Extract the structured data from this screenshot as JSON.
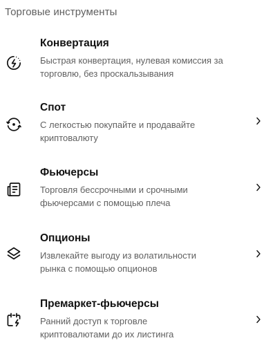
{
  "section": {
    "title": "Торговые инструменты"
  },
  "items": [
    {
      "name": "Конвертация",
      "desc_line1": "Быстрая конвертация, нулевая комиссия за",
      "desc_line2": "торговлю, без проскальзывания",
      "icon": "convert-icon",
      "has_chevron": false
    },
    {
      "name": "Спот",
      "desc_line1": "С легкостью покупайте и продавайте",
      "desc_line2": "криптовалюту",
      "icon": "spot-icon",
      "has_chevron": true
    },
    {
      "name": "Фьючерсы",
      "desc_line1": "Торговля бессрочными и срочными",
      "desc_line2": "фьючерсами с помощью плеча",
      "icon": "futures-icon",
      "has_chevron": true
    },
    {
      "name": "Опционы",
      "desc_line1": "Извлекайте выгоду из волатильности",
      "desc_line2": "рынка с помощью опционов",
      "icon": "options-icon",
      "has_chevron": true
    },
    {
      "name": "Премаркет-фьючерсы",
      "desc_line1": "Ранний доступ к торговле",
      "desc_line2": "криптовалютами до их листинга",
      "icon": "premarket-futures-icon",
      "has_chevron": true
    }
  ],
  "colors": {
    "text_primary": "#121212",
    "text_secondary": "#5f5f5f",
    "background": "#ffffff"
  }
}
